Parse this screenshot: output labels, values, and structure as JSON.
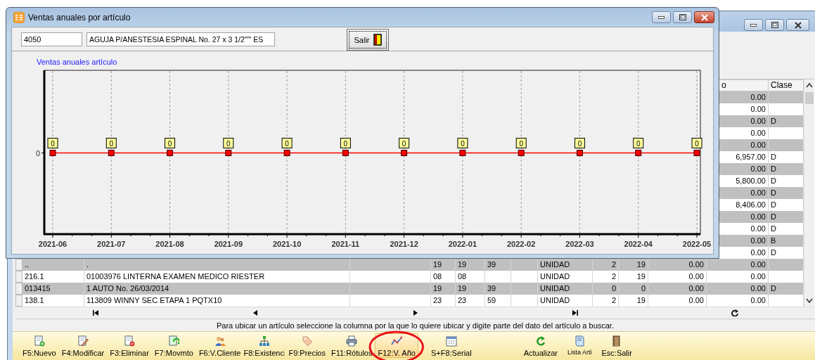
{
  "dialog": {
    "title": "Ventas anuales por artículo",
    "code_field": {
      "value": "4050"
    },
    "description_field": {
      "value": "AGUJA P/ANESTESIA ESPINAL No. 27 x 3 1/2\"\"' ES"
    },
    "exit_button": {
      "label": "Salir"
    },
    "chart": {
      "title": "Ventas anuales artículo",
      "x_labels": [
        "2021-06",
        "2021-07",
        "2021-08",
        "2021-09",
        "2021-10",
        "2021-11",
        "2021-12",
        "2022-01",
        "2022-02",
        "2022-03",
        "2022-04",
        "2022-05"
      ],
      "point_labels": [
        "0",
        "0",
        "0",
        "0",
        "0",
        "0",
        "0",
        "0",
        "0",
        "0",
        "0",
        "0"
      ],
      "y_axis_tick": "0"
    }
  },
  "grid": {
    "header": [
      "o",
      "Clase"
    ],
    "side_rows": [
      [
        "0.00",
        null
      ],
      [
        "0.00",
        null
      ],
      [
        "0.00",
        "D"
      ],
      [
        "0.00",
        null
      ],
      [
        "0.00",
        null
      ],
      [
        "6,957.00",
        "D"
      ],
      [
        "0.00",
        "D"
      ],
      [
        "5,800.00",
        "D"
      ],
      [
        "0.00",
        "D"
      ],
      [
        "8,406.00",
        "D"
      ],
      [
        "0.00",
        "D"
      ],
      [
        "0.00",
        "D"
      ],
      [
        "0.00",
        "B"
      ],
      [
        "0.00",
        "D"
      ]
    ],
    "rows": [
      [
        "..",
        ".",
        null,
        "19",
        "19",
        "39",
        null,
        "UNIDAD",
        "2",
        "19",
        "0.00",
        "0.00",
        null
      ],
      [
        "216.1",
        "01003976 LINTERNA EXAMEN MEDICO RIESTER",
        null,
        "08",
        "08",
        null,
        null,
        "UNIDAD",
        "2",
        "19",
        "0.00",
        "0.00",
        null
      ],
      [
        "013415",
        "1 AUTO No. 26/03/2014",
        null,
        "19",
        "19",
        "39",
        null,
        "UNIDAD",
        "0",
        "0",
        "0.00",
        "0.00",
        "D"
      ],
      [
        "138.1",
        "113809 WINNY SEC ETAPA 1 PQTX10",
        null,
        "23",
        "23",
        "59",
        null,
        "UNIDAD",
        "2",
        "19",
        "0.00",
        "0.00",
        null
      ]
    ]
  },
  "status_bar": {
    "text": "Para ubicar un artículo seleccione la columna por la que lo quiere ubicar y digite parte del dato del artículo a buscar."
  },
  "toolbar": [
    {
      "label": "F5:Nuevo",
      "selected": false,
      "circled": false
    },
    {
      "label": "F4:Modificar",
      "selected": false,
      "circled": false
    },
    {
      "label": "F3:Eliminar",
      "selected": false,
      "circled": false
    },
    {
      "label": "F7:Movmto",
      "selected": false,
      "circled": false
    },
    {
      "label": "F6:V.Cliente",
      "selected": false,
      "circled": false
    },
    {
      "label": "F8:Existenci",
      "selected": false,
      "circled": false
    },
    {
      "label": "F9:Precios",
      "selected": false,
      "circled": false
    },
    {
      "label": "F11:Rótulos",
      "selected": false,
      "circled": false
    },
    {
      "label": "F12:V. Año",
      "selected": true,
      "circled": true
    },
    {
      "label": "S+F8:Serial",
      "selected": false,
      "circled": false
    },
    {
      "label": "Actualizar",
      "selected": false,
      "circled": false
    },
    {
      "label": "Lista Arti",
      "selected": false,
      "circled": false
    },
    {
      "label": "Esc:Salir",
      "selected": false,
      "circled": false
    }
  ]
}
